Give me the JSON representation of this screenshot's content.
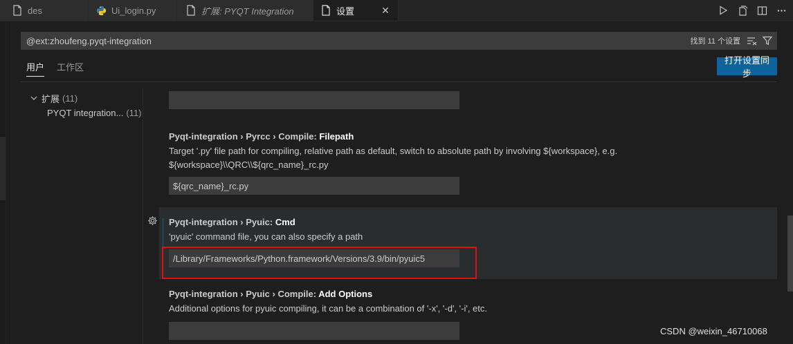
{
  "tabs": [
    {
      "label": "des",
      "icon": "file-icon",
      "active": false,
      "italic": false
    },
    {
      "label": "Ui_login.py",
      "icon": "python-icon",
      "active": false,
      "italic": false
    },
    {
      "label": "扩展: PYQT Integration",
      "icon": "file-icon",
      "active": false,
      "italic": true
    },
    {
      "label": "设置",
      "icon": "file-icon",
      "active": true,
      "italic": false
    }
  ],
  "tab_actions": [
    "run-icon",
    "open-changes-icon",
    "split-editor-icon",
    "more-actions-icon"
  ],
  "search": {
    "value": "@ext:zhoufeng.pyqt-integration",
    "count": "找到 11 个设置"
  },
  "scope_tabs": [
    "用户",
    "工作区"
  ],
  "sync_button": "打开设置同步",
  "toc": {
    "group_label": "扩展",
    "group_count": "(11)",
    "item_label": "PYQT integration...",
    "item_count": "(11)"
  },
  "settings": [
    {
      "category": "Pyqt-integration › Pyrcc › Compile: ",
      "key": "Filepath",
      "desc_line1": "Target '.py' file path for compiling, relative path as default, switch to absolute path by involving ${workspace}, e.g.",
      "desc_line2": "${workspace}\\\\QRC\\\\${qrc_name}_rc.py",
      "value": "${qrc_name}_rc.py"
    },
    {
      "category": "Pyqt-integration › Pyuic: ",
      "key": "Cmd",
      "desc_line1": "'pyuic' command file, you can also specify a path",
      "value": "/Library/Frameworks/Python.framework/Versions/3.9/bin/pyuic5"
    },
    {
      "category": "Pyqt-integration › Pyuic › Compile: ",
      "key": "Add Options",
      "desc_line1": "Additional options for pyuic compiling, it can be a combination of '-x', '-d', '-i', etc.",
      "value": ""
    }
  ],
  "watermark": "CSDN @weixin_46710068",
  "colors": {
    "accent": "#0e639c",
    "highlight": "#e01010",
    "background": "#1e1e1e"
  }
}
